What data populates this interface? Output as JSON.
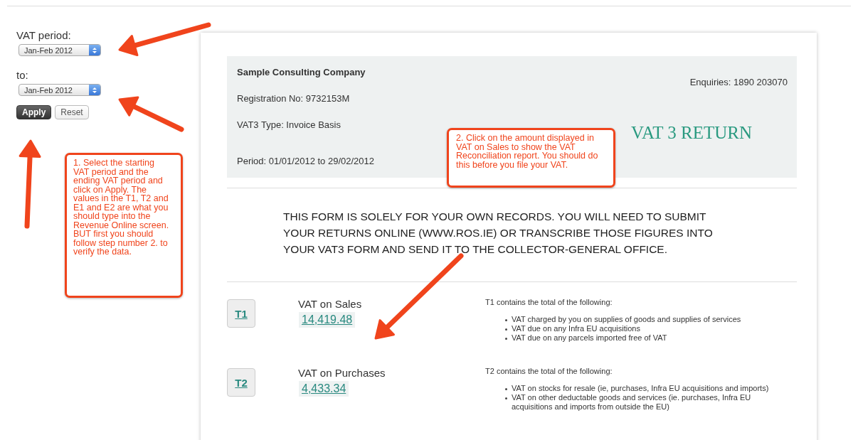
{
  "sidebar": {
    "period_label": "VAT period:",
    "period_value": "Jan-Feb 2012",
    "to_label": "to:",
    "to_value": "Jan-Feb 2012",
    "buttons": [
      {
        "label": "Apply",
        "kind": "primary"
      },
      {
        "label": "Reset",
        "kind": "secondary"
      }
    ]
  },
  "callouts": [
    "1. Select the starting VAT period and the ending VAT period and click on Apply. The values in the T1, T2 and E1 and E2 are what you should type into the Revenue Online screen. BUT first you should follow step number 2. to verify the data.",
    "2. Click on the amount displayed in VAT on Sales to show the VAT Reconciliation report. You should do this before you file your VAT."
  ],
  "header": {
    "company": "Sample Consulting Company",
    "registration": "Registration No: 9732153M",
    "vat3_type": "VAT3 Type: Invoice Basis",
    "period": "Period: 01/01/2012 to 29/02/2012",
    "enquiries": "Enquiries: 1890 203070",
    "title": "VAT 3 RETURN"
  },
  "notice": "THIS FORM IS SOLELY FOR YOUR OWN RECORDS. YOU WILL NEED TO SUBMIT YOUR RETURNS ONLINE (WWW.ROS.IE) OR TRANSCRIBE THOSE FIGURES INTO YOUR VAT3 FORM AND SEND IT TO THE COLLECTOR-GENERAL OFFICE.",
  "rows": [
    {
      "code": "T1",
      "label": "VAT on Sales",
      "amount": "14,419.48",
      "intro": "T1 contains the total of the following:",
      "items": [
        "VAT charged by you on supplies of goods and supplies of services",
        "VAT due on any Infra EU acquisitions",
        "VAT due on any parcels imported free of VAT"
      ]
    },
    {
      "code": "T2",
      "label": "VAT on Purchases",
      "amount": "4,433.34",
      "intro": "T2 contains the total of the following:",
      "items": [
        "VAT on stocks for resale (ie, purchases, Infra EU acquisitions and imports)",
        "VAT on other deductable goods and services (ie. purchases, Infra EU acquisitions and imports from outside the EU)"
      ]
    }
  ]
}
